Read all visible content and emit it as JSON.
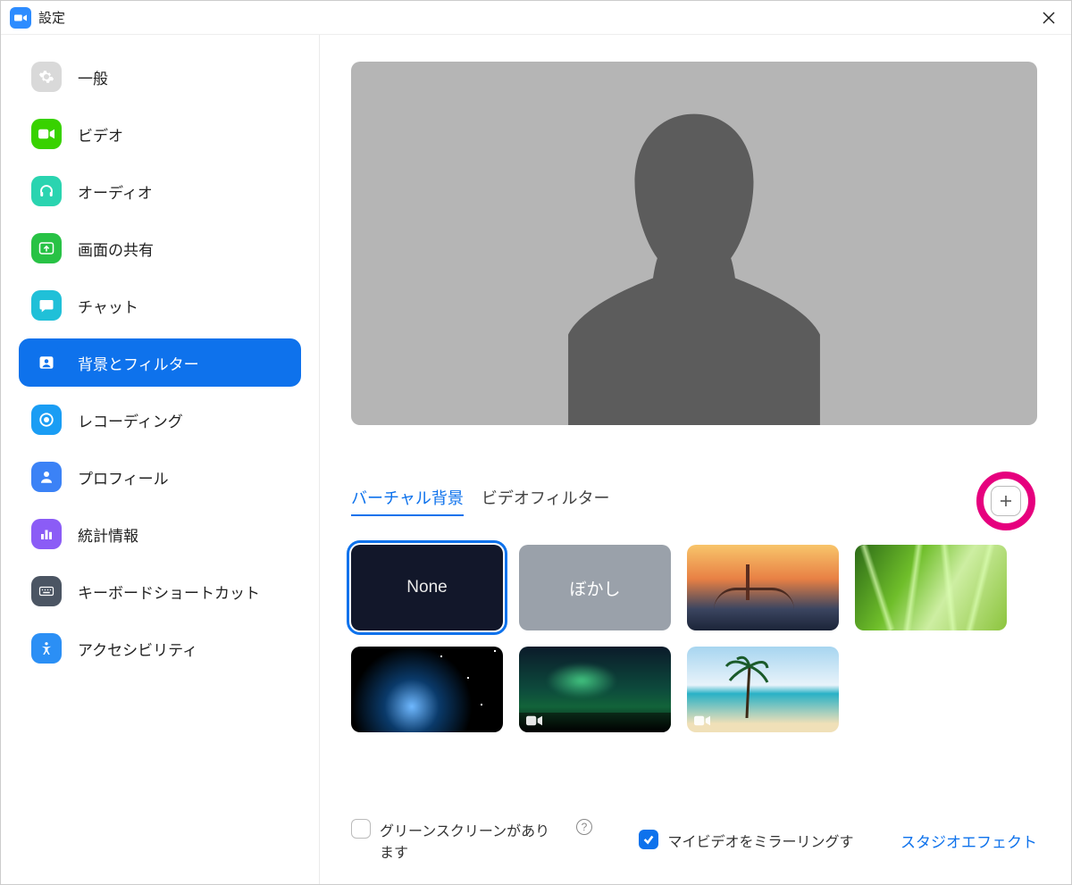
{
  "window": {
    "title": "設定"
  },
  "sidebar": {
    "items": [
      {
        "label": "一般",
        "icon": "gear-icon",
        "bgColor": "#d9d9d9"
      },
      {
        "label": "ビデオ",
        "icon": "video-icon",
        "bgColor": "#38d200"
      },
      {
        "label": "オーディオ",
        "icon": "headphones-icon",
        "bgColor": "#2ad4b0"
      },
      {
        "label": "画面の共有",
        "icon": "share-screen-icon",
        "bgColor": "#28c245"
      },
      {
        "label": "チャット",
        "icon": "chat-icon",
        "bgColor": "#20c0d8"
      },
      {
        "label": "背景とフィルター",
        "icon": "person-icon",
        "bgColor": "#0e72ec",
        "active": true
      },
      {
        "label": "レコーディング",
        "icon": "record-icon",
        "bgColor": "#1a9df4"
      },
      {
        "label": "プロフィール",
        "icon": "profile-icon",
        "bgColor": "#3b82f6"
      },
      {
        "label": "統計情報",
        "icon": "stats-icon",
        "bgColor": "#8b5cf6"
      },
      {
        "label": "キーボードショートカット",
        "icon": "keyboard-icon",
        "bgColor": "#4b5563"
      },
      {
        "label": "アクセシビリティ",
        "icon": "accessibility-icon",
        "bgColor": "#2b8ff5"
      }
    ]
  },
  "tabs": {
    "virtual_bg": "バーチャル背景",
    "video_filter": "ビデオフィルター",
    "active": "virtual_bg"
  },
  "backgrounds": {
    "none_label": "None",
    "blur_label": "ぼかし",
    "items": [
      {
        "id": "none",
        "selected": true
      },
      {
        "id": "blur"
      },
      {
        "id": "bridge"
      },
      {
        "id": "grass"
      },
      {
        "id": "earth"
      },
      {
        "id": "aurora",
        "hasVideo": true
      },
      {
        "id": "beach",
        "hasVideo": true
      }
    ]
  },
  "options": {
    "greenscreen_label": "グリーンスクリーンがあります",
    "greenscreen_checked": false,
    "mirror_label": "マイビデオをミラーリングす",
    "mirror_checked": true,
    "studio_effects_label": "スタジオエフェクト"
  }
}
